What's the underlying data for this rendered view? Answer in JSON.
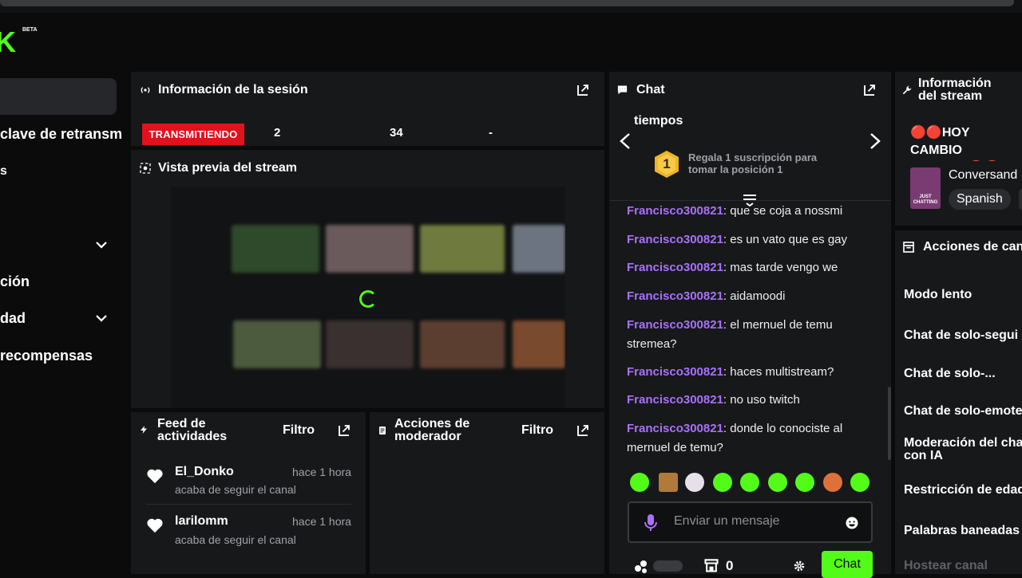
{
  "logo": {
    "text": "K",
    "beta": "BETA"
  },
  "sidebar": {
    "items": [
      {
        "label": "clave de retransm"
      },
      {
        "label": "s"
      },
      {
        "label": "ción"
      },
      {
        "label": "dad"
      },
      {
        "label": "recompensas"
      }
    ]
  },
  "session": {
    "title": "Información de la sesión",
    "live_badge": "TRANSMITIENDO",
    "stat_1": "2",
    "stat_2": "34",
    "stat_3": "-"
  },
  "preview": {
    "title": "Vista previa del stream"
  },
  "feed": {
    "title": "Feed de actividades",
    "filter": "Filtro",
    "items": [
      {
        "name": "El_Donko",
        "time": "hace 1 hora",
        "action": "acaba de seguir el canal"
      },
      {
        "name": "larilomm",
        "time": "hace 1 hora",
        "action": "acaba de seguir el canal"
      }
    ]
  },
  "modactions": {
    "title": "Acciones de moderador",
    "filter": "Filtro"
  },
  "chat": {
    "title": "Chat",
    "pinned_top": "tiempos",
    "gift_text": "Regala 1 suscripción para tomar la posición 1",
    "gift_rank": "1",
    "messages": [
      {
        "user": "Francisco300821",
        "text": ": que se coja a nossmi"
      },
      {
        "user": "Francisco300821",
        "text": ": es un vato que es gay"
      },
      {
        "user": "Francisco300821",
        "text": ": mas tarde vengo we"
      },
      {
        "user": "Francisco300821",
        "text": ": aidamoodi"
      },
      {
        "user": "Francisco300821",
        "text": ": el mernuel de temu stremea?"
      },
      {
        "user": "Francisco300821",
        "text": ": haces multistream?"
      },
      {
        "user": "Francisco300821",
        "text": ": no uso twitch"
      },
      {
        "user": "Francisco300821",
        "text": ": donde lo conociste al mernuel de temu?"
      }
    ],
    "input_placeholder": "Enviar un mensaje",
    "store_count": "0",
    "send_label": "Chat"
  },
  "stream_info": {
    "title": "Información del stream",
    "stream_title": "🔴🔴HOY CAMBIO VIDAAAA🔴🔴",
    "category": "Conversand",
    "language": "Spanish",
    "category_thumb_text": "JUST CHATTING"
  },
  "channel_actions": {
    "title": "Acciones de can",
    "items": [
      {
        "label": "Modo lento"
      },
      {
        "label": "Chat de solo-segui"
      },
      {
        "label": "Chat de solo-..."
      },
      {
        "label": "Chat de solo-emote"
      },
      {
        "label": "Moderación del cha con IA"
      },
      {
        "label": "Restricción de edad"
      },
      {
        "label": "Palabras baneadas"
      },
      {
        "label": "Hostear canal"
      }
    ]
  },
  "colors": {
    "accent": "#53fc18",
    "live": "#e1121e",
    "username": "#a970ff",
    "panel": "#17181a"
  }
}
